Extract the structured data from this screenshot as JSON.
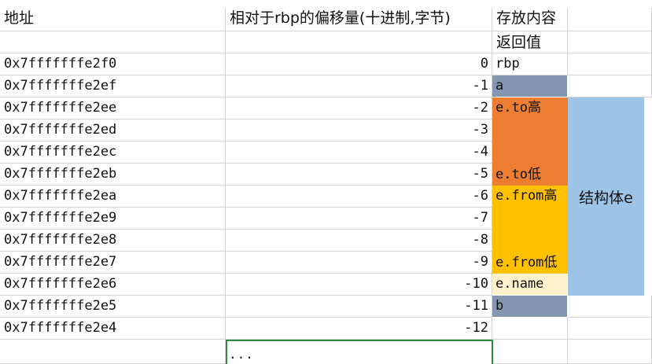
{
  "colors": {
    "grid_line": "#d4d4d4",
    "slate": "#8497b0",
    "orange": "#ed7d31",
    "yellow": "#ffc000",
    "cream": "#fff2cc",
    "light_blue": "#9dc3e6",
    "selection_green": "#2e8b3e"
  },
  "header": {
    "col_address": "地址",
    "col_offset": "相对于rbp的偏移量(十进制,字节)",
    "col_content": "存放内容",
    "col_content_sub": "返回值"
  },
  "rows": [
    {
      "address": "0x7fffffffe2f0",
      "offset": "0"
    },
    {
      "address": "0x7fffffffe2ef",
      "offset": "-1"
    },
    {
      "address": "0x7fffffffe2ee",
      "offset": "-2"
    },
    {
      "address": "0x7fffffffe2ed",
      "offset": "-3"
    },
    {
      "address": "0x7fffffffe2ec",
      "offset": "-4"
    },
    {
      "address": "0x7fffffffe2eb",
      "offset": "-5"
    },
    {
      "address": "0x7fffffffe2ea",
      "offset": "-6"
    },
    {
      "address": "0x7fffffffe2e9",
      "offset": "-7"
    },
    {
      "address": "0x7fffffffe2e8",
      "offset": "-8"
    },
    {
      "address": "0x7fffffffe2e7",
      "offset": "-9"
    },
    {
      "address": "0x7fffffffe2e6",
      "offset": "-10"
    },
    {
      "address": "0x7fffffffe2e5",
      "offset": "-11"
    },
    {
      "address": "0x7fffffffe2e4",
      "offset": "-12"
    }
  ],
  "contents": {
    "rbp": "rbp",
    "a": "a",
    "e_to_high": "e.to高",
    "e_to_low": "e.to低",
    "e_from_high": "e.from高",
    "e_from_low": "e.from低",
    "e_name": "e.name",
    "b": "b"
  },
  "struct_label": "结构体e",
  "selected_cell_text": "..."
}
